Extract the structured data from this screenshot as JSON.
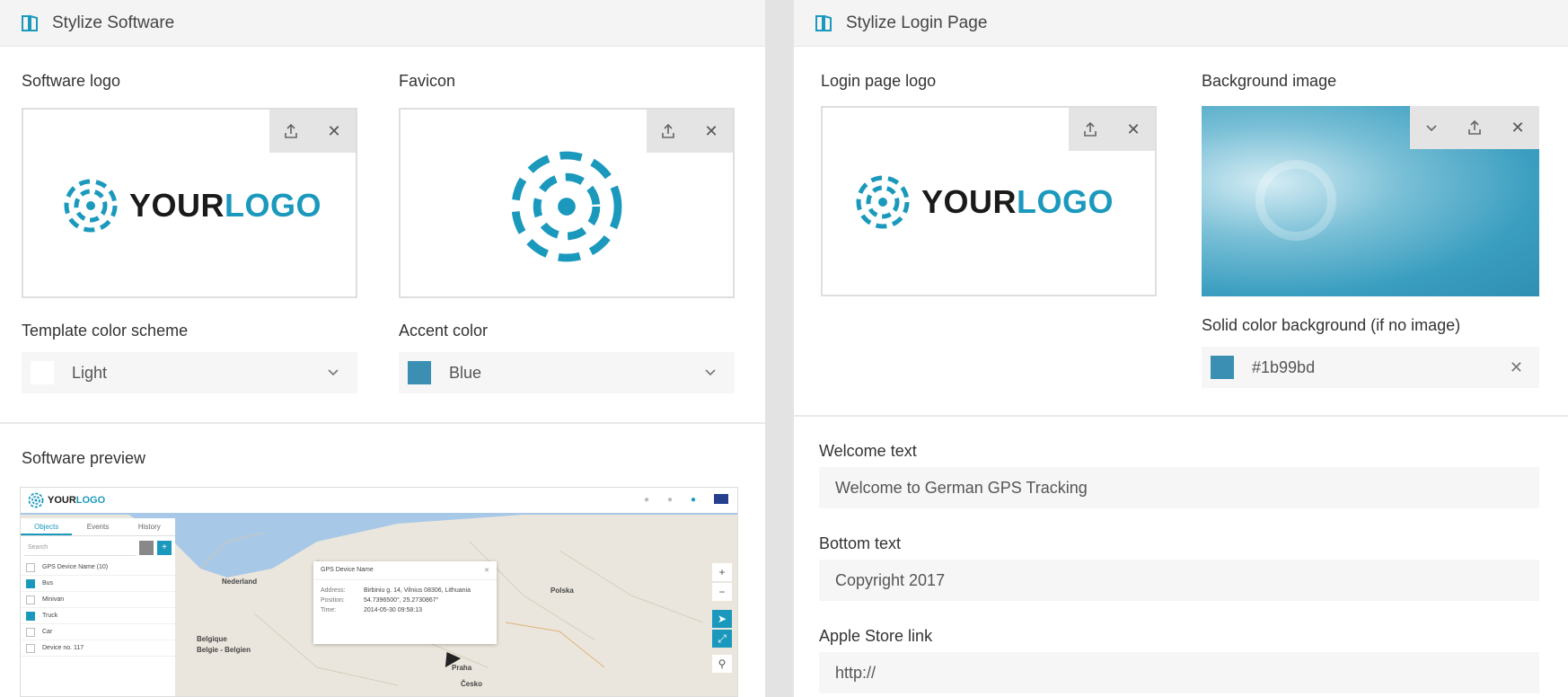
{
  "left_panel": {
    "title": "Stylize Software",
    "software_logo_label": "Software logo",
    "favicon_label": "Favicon",
    "logo_text_dark": "YOUR",
    "logo_text_accent": "LOGO",
    "template_color_label": "Template color scheme",
    "template_color_value": "Light",
    "accent_color_label": "Accent color",
    "accent_color_value": "Blue",
    "preview_label": "Software preview"
  },
  "preview": {
    "logo_dark": "YOUR",
    "logo_accent": "LOGO",
    "tabs": [
      "Objects",
      "Events",
      "History"
    ],
    "search_placeholder": "Search",
    "group_name": "GPS Device Name (10)",
    "devices": [
      {
        "name": "Bus",
        "checked": true
      },
      {
        "name": "Minivan",
        "checked": false
      },
      {
        "name": "Truck",
        "checked": true
      },
      {
        "name": "Car",
        "checked": false
      },
      {
        "name": "Device no. 117",
        "checked": false
      }
    ],
    "popup": {
      "title": "GPS Device Name",
      "address_label": "Address:",
      "address_value": "Birbiniu g. 14, Vilnius 08306, Lithuania",
      "position_label": "Position:",
      "position_value": "54.7396500°, 25.2730867°",
      "time_label": "Time:",
      "time_value": "2014-05-30 09:58:13"
    },
    "map_labels": [
      "Nederland",
      "Polska",
      "Belgique",
      "Belgie - Belgien",
      "Praha",
      "Česko"
    ]
  },
  "right_panel": {
    "title": "Stylize Login Page",
    "login_logo_label": "Login page logo",
    "background_label": "Background image",
    "solid_bg_label": "Solid color background (if no image)",
    "solid_bg_value": "#1b99bd",
    "welcome_label": "Welcome text",
    "welcome_value": "Welcome to German GPS Tracking",
    "bottom_label": "Bottom text",
    "bottom_value": "Copyright 2017",
    "apple_label": "Apple Store link",
    "apple_value": "http://"
  },
  "colors": {
    "accent": "#1b99bd",
    "light_swatch": "#ffffff",
    "blue_swatch": "#3a8fb2"
  },
  "icons": [
    "panels-icon",
    "upload-icon",
    "close-icon",
    "chevron-down-icon"
  ]
}
